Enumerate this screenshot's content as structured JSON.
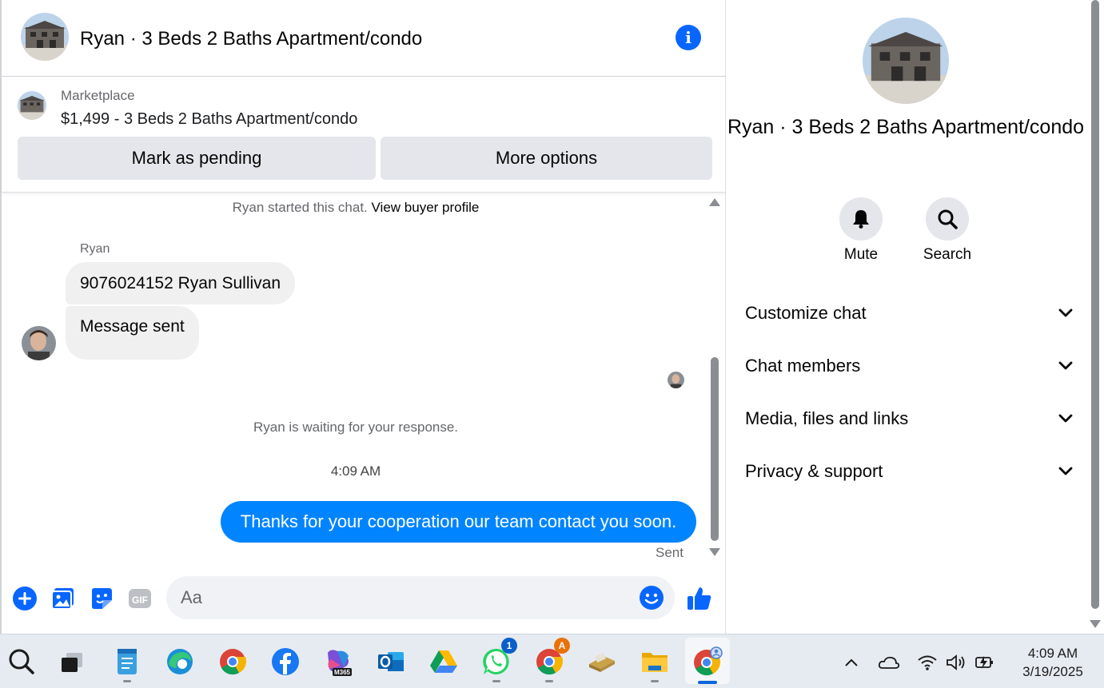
{
  "header": {
    "title": "Ryan · 3 Beds 2 Baths Apartment/condo",
    "info_icon": "info-icon"
  },
  "marketplace": {
    "label": "Marketplace",
    "listing": "$1,499 - 3 Beds 2 Baths Apartment/condo",
    "mark_pending": "Mark as pending",
    "more_options": "More options"
  },
  "thread": {
    "started": "Ryan started this chat.",
    "view_profile": "View buyer profile",
    "sender_name": "Ryan",
    "messages_in": [
      "9076024152 Ryan Sullivan",
      "Message sent"
    ],
    "waiting": "Ryan is waiting for your response.",
    "timestamp": "4:09 AM",
    "message_out": "Thanks for your cooperation our team contact you soon.",
    "status": "Sent"
  },
  "composer": {
    "placeholder": "Aa"
  },
  "info_panel": {
    "title": "Ryan · 3 Beds 2 Baths Apartment/condo",
    "mute_label": "Mute",
    "search_label": "Search",
    "sections": [
      "Customize chat",
      "Chat members",
      "Media, files and links",
      "Privacy & support"
    ]
  },
  "taskbar": {
    "apps": [
      "Search",
      "Task View",
      "Notepad",
      "Microsoft Edge",
      "Google Chrome",
      "Facebook",
      "Microsoft 365",
      "Outlook",
      "Google Drive",
      "WhatsApp",
      "Chrome Profile",
      "Pharos",
      "File Explorer",
      "Chrome Active"
    ],
    "whatsapp_badge": "1",
    "chrome_badge": "A",
    "m365_label": "M365",
    "time": "4:09 AM",
    "date": "3/19/2025"
  },
  "colors": {
    "accent": "#0084ff",
    "brand_blue": "#0866ff",
    "bubble_in": "#f0f0f0",
    "button_gray": "#e4e6eb"
  }
}
